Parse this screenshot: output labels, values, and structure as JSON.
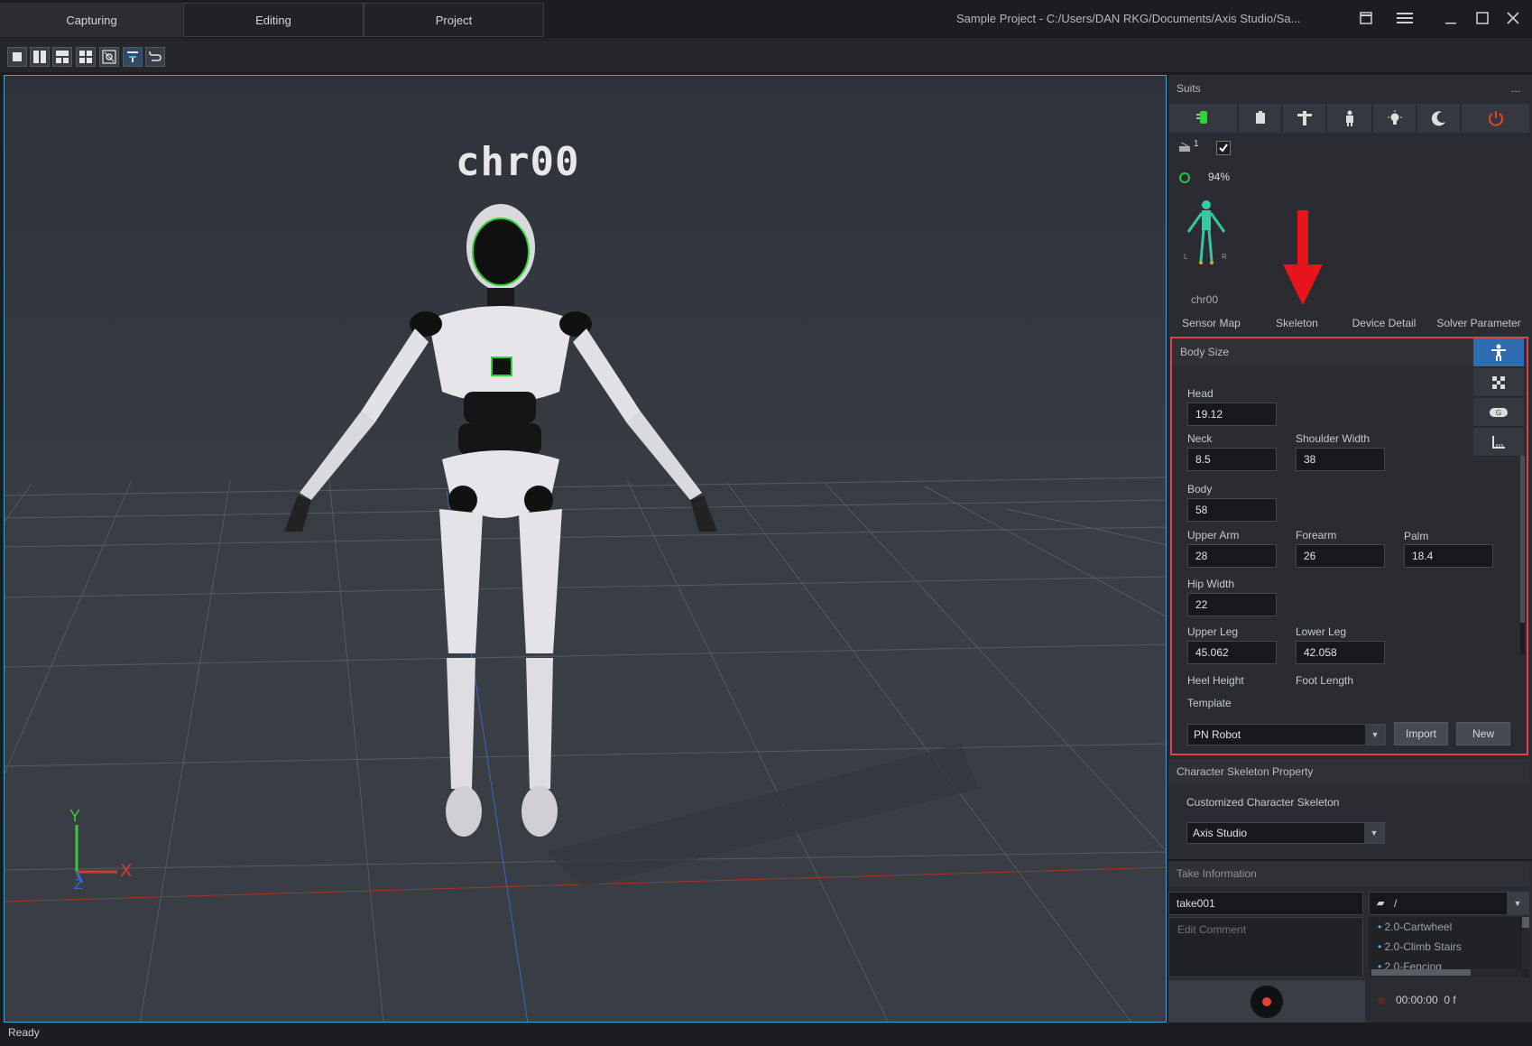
{
  "tabs": [
    {
      "label": "Capturing",
      "active": true
    },
    {
      "label": "Editing",
      "active": false
    },
    {
      "label": "Project",
      "active": false
    }
  ],
  "window_title": "Sample Project - C:/Users/DAN RKG/Documents/Axis Studio/Sa...",
  "viewport": {
    "character_label": "chr00",
    "axes": {
      "x": "X",
      "y": "Y",
      "z": "Z"
    }
  },
  "status": "Ready",
  "suits": {
    "title": "Suits",
    "menu": "...",
    "device_count": "1",
    "battery": "94%",
    "character": "chr00",
    "figure_sides": {
      "left": "L",
      "right": "R"
    },
    "tabs": [
      "Sensor Map",
      "Skeleton",
      "Device Detail",
      "Solver Parameter"
    ]
  },
  "body_size": {
    "title": "Body Size",
    "fields": {
      "head": {
        "label": "Head",
        "value": "19.12"
      },
      "neck": {
        "label": "Neck",
        "value": "8.5"
      },
      "shoulder_width": {
        "label": "Shoulder Width",
        "value": "38"
      },
      "body": {
        "label": "Body",
        "value": "58"
      },
      "upper_arm": {
        "label": "Upper Arm",
        "value": "28"
      },
      "forearm": {
        "label": "Forearm",
        "value": "26"
      },
      "palm": {
        "label": "Palm",
        "value": "18.4"
      },
      "hip_width": {
        "label": "Hip Width",
        "value": "22"
      },
      "upper_leg": {
        "label": "Upper Leg",
        "value": "45.062"
      },
      "lower_leg": {
        "label": "Lower Leg",
        "value": "42.058"
      },
      "heel_height": {
        "label": "Heel Height"
      },
      "foot_length": {
        "label": "Foot Length"
      }
    },
    "template": {
      "label": "Template",
      "value": "PN Robot",
      "import": "Import",
      "new": "New"
    }
  },
  "character_skeleton": {
    "title": "Character Skeleton Property",
    "label": "Customized Character Skeleton",
    "value": "Axis Studio"
  },
  "take_info": {
    "title": "Take Information",
    "name": "take001",
    "folder": "/",
    "comment_placeholder": "Edit Comment",
    "takes": [
      "2.0-Cartwheel",
      "2.0-Climb Stairs",
      "2.0-Fencing"
    ],
    "timecode": "00:00:00  0 f"
  },
  "colors": {
    "accent_blue": "#3fa3d6",
    "highlight_red": "#e04046",
    "annotation_arrow": "#e8141c",
    "record_red": "#e8432a",
    "ok_green": "#22c44a"
  }
}
